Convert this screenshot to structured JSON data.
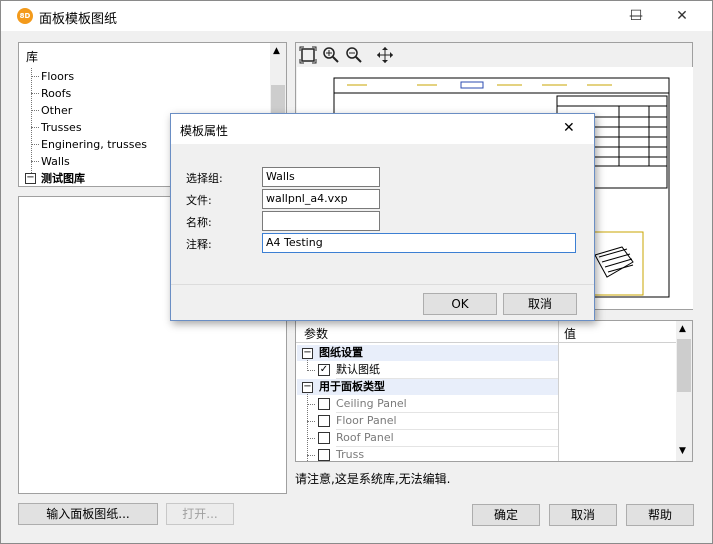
{
  "window": {
    "title": "面板模板图纸",
    "icon_text": "8D",
    "minimize": "—",
    "maximize": "☐",
    "close": "✕"
  },
  "library": {
    "root": "库",
    "items": [
      "Floors",
      "Roofs",
      "Other",
      "Trusses",
      "Enginering, trusses",
      "Walls"
    ],
    "test_lib": "测试图库",
    "collapse_glyph": "−"
  },
  "preview_toolbar": {
    "fit": "fit-icon",
    "zoom_in": "zoom-in-icon",
    "zoom_out": "zoom-out-icon",
    "pan": "pan-icon"
  },
  "dialog": {
    "title": "模板属性",
    "close": "✕",
    "labels": {
      "group": "选择组:",
      "file": "文件:",
      "name": "名称:",
      "note": "注释:"
    },
    "values": {
      "group": "Walls",
      "file": "wallpnl_a4.vxp",
      "name": "",
      "note": "A4 Testing"
    },
    "ok": "OK",
    "cancel": "取消"
  },
  "params": {
    "col_param": "参数",
    "col_value": "值",
    "rows": [
      {
        "label": "图纸设置",
        "type": "group"
      },
      {
        "label": "默认图纸",
        "type": "check",
        "checked": true
      },
      {
        "label": "用于面板类型",
        "type": "group"
      },
      {
        "label": "Ceiling Panel",
        "type": "check",
        "checked": false
      },
      {
        "label": "Floor Panel",
        "type": "check",
        "checked": false
      },
      {
        "label": "Roof Panel",
        "type": "check",
        "checked": false
      },
      {
        "label": "Truss",
        "type": "check",
        "checked": false
      }
    ]
  },
  "notice": "请注意,这是系统库,无法编辑.",
  "buttons": {
    "import": "输入面板图纸...",
    "open": "打开...",
    "confirm": "确定",
    "cancel": "取消",
    "help": "帮助"
  }
}
